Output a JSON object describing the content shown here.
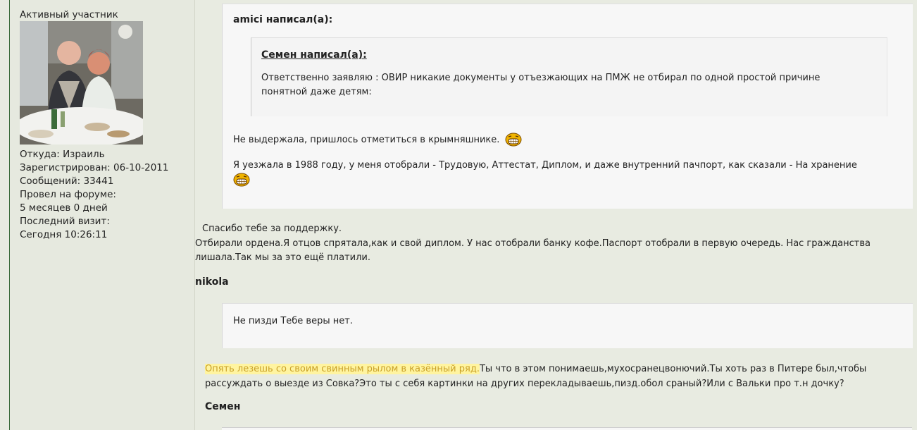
{
  "profile": {
    "rank": "Активный участник",
    "location": "Откуда: Израиль",
    "registered": "Зарегистрирован: 06-10-2011",
    "messages": "Сообщений: 33441",
    "time_on_forum_label": "Провел на форуме:",
    "time_on_forum_value": "5 месяцев 0 дней",
    "last_visit_label": "Последний визит:",
    "last_visit_value": "Сегодня 10:26:11"
  },
  "post": {
    "outer_quote": {
      "author": "amici написал(а):",
      "inner_quote": {
        "author": "Семен написал(а):",
        "text": "Ответственно заявляю : ОВИР никакие документы у отъезжающих на ПМЖ не отбирал по одной простой причине понятной даже детям:"
      },
      "line1": "Не выдержала, пришлось отметиться в крымняшнике.",
      "line2": "Я уезжала в 1988 году, у меня отобрали - Трудовую, Аттестат, Диплом, и даже внутренний пачпорт, как сказали - На хранение"
    },
    "reply1": {
      "line1": "Спасибо тебе за поддержку.",
      "line2": "Отбирали ордена.Я отцов спрятала,как и свой диплом. У нас отобрали банку кофе.Паспорт отобрали в первую очередь.  Нас гражданства лишала.Так мы за это ещё платили."
    },
    "author2": "nikola",
    "quote2": {
      "text": "Не пизди Тебе веры нет."
    },
    "reply2": {
      "highlighted": "Опять лезешь со своим  свинным рылом в казённый ряд.",
      "rest": "Ты что в этом понимаешь,мухосранецвонючий.Ты хоть раз в Питере был,чтобы рассуждать о выезде из Совка?Это ты с себя картинки на других перекладываешь,пизд.обол сраный?Или  с Вальки  про т.н дочку?"
    },
    "author3": "Семен",
    "emoji_icon": "laughing-smiley-icon"
  }
}
